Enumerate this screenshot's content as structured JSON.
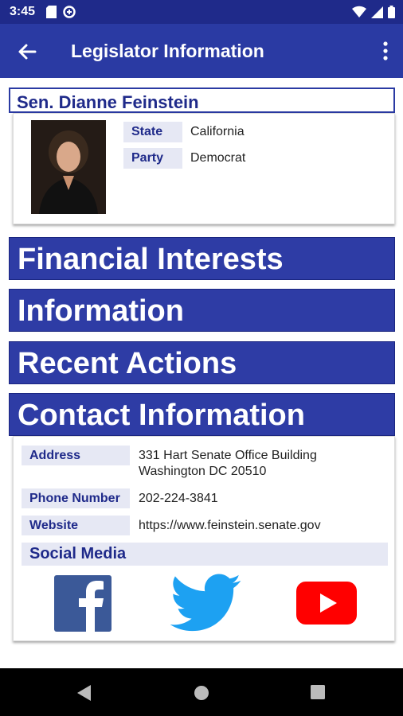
{
  "status_bar": {
    "time": "3:45"
  },
  "app_bar": {
    "title": "Legislator Information"
  },
  "legislator": {
    "name": "Sen. Dianne Feinstein",
    "state_label": "State",
    "state_value": "California",
    "party_label": "Party",
    "party_value": "Democrat"
  },
  "sections": {
    "financial": "Financial Interests",
    "information": "Information",
    "recent_actions": "Recent Actions",
    "contact": "Contact Information"
  },
  "contact": {
    "address_label": "Address",
    "address_line1": "331 Hart Senate Office Building",
    "address_line2": "Washington DC 20510",
    "phone_label": "Phone Number",
    "phone_value": "202-224-3841",
    "website_label": "Website",
    "website_value": "https://www.feinstein.senate.gov",
    "social_label": "Social Media"
  },
  "social_icons": [
    "facebook-icon",
    "twitter-icon",
    "youtube-icon"
  ],
  "colors": {
    "primary": "#2a3aa3",
    "status_bar": "#1f2a8a",
    "label_bg": "#e6e8f4",
    "facebook": "#3b5998",
    "twitter": "#1da1f2",
    "youtube": "#ff0000"
  }
}
